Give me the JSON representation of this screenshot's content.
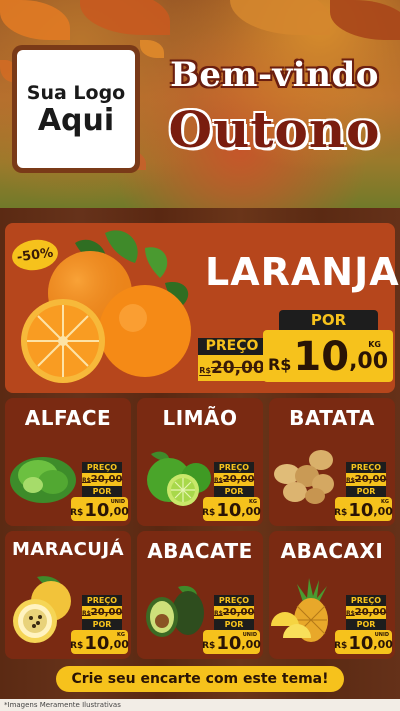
{
  "header": {
    "logo_line1": "Sua Logo",
    "logo_line2": "Aqui",
    "welcome": "Bem-vindo",
    "season": "Outono"
  },
  "featured": {
    "name": "LARANJA",
    "discount": "-50%",
    "price_label": "PREÇO",
    "old_currency": "R$",
    "old_price": "20,00",
    "new_label": "POR",
    "new_currency": "R$",
    "new_int": "10",
    "new_dec": ",00",
    "unit": "KG"
  },
  "products": [
    {
      "name": "ALFACE",
      "price_label": "PREÇO",
      "old_currency": "R$",
      "old_price": "20,00",
      "new_label": "POR",
      "new_currency": "R$",
      "new_int": "10",
      "new_dec": ",00",
      "unit": "UNID"
    },
    {
      "name": "LIMÃO",
      "price_label": "PREÇO",
      "old_currency": "R$",
      "old_price": "20,00",
      "new_label": "POR",
      "new_currency": "R$",
      "new_int": "10",
      "new_dec": ",00",
      "unit": "KG"
    },
    {
      "name": "BATATA",
      "price_label": "PREÇO",
      "old_currency": "R$",
      "old_price": "20,00",
      "new_label": "POR",
      "new_currency": "R$",
      "new_int": "10",
      "new_dec": ",00",
      "unit": "KG"
    },
    {
      "name": "MARACUJÁ",
      "price_label": "PREÇO",
      "old_currency": "R$",
      "old_price": "20,00",
      "new_label": "POR",
      "new_currency": "R$",
      "new_int": "10",
      "new_dec": ",00",
      "unit": "KG"
    },
    {
      "name": "ABACATE",
      "price_label": "PREÇO",
      "old_currency": "R$",
      "old_price": "20,00",
      "new_label": "POR",
      "new_currency": "R$",
      "new_int": "10",
      "new_dec": ",00",
      "unit": "UNID"
    },
    {
      "name": "ABACAXI",
      "price_label": "PREÇO",
      "old_currency": "R$",
      "old_price": "20,00",
      "new_label": "POR",
      "new_currency": "R$",
      "new_int": "10",
      "new_dec": ",00",
      "unit": "UNID"
    }
  ],
  "cta": "Crie seu encarte com este tema!",
  "footnote": "*Imagens Meramente Ilustrativas",
  "colors": {
    "accent": "#f6c21c",
    "card": "#7a2a12",
    "featured_card": "#b6461c",
    "board": "#5b2a13"
  }
}
